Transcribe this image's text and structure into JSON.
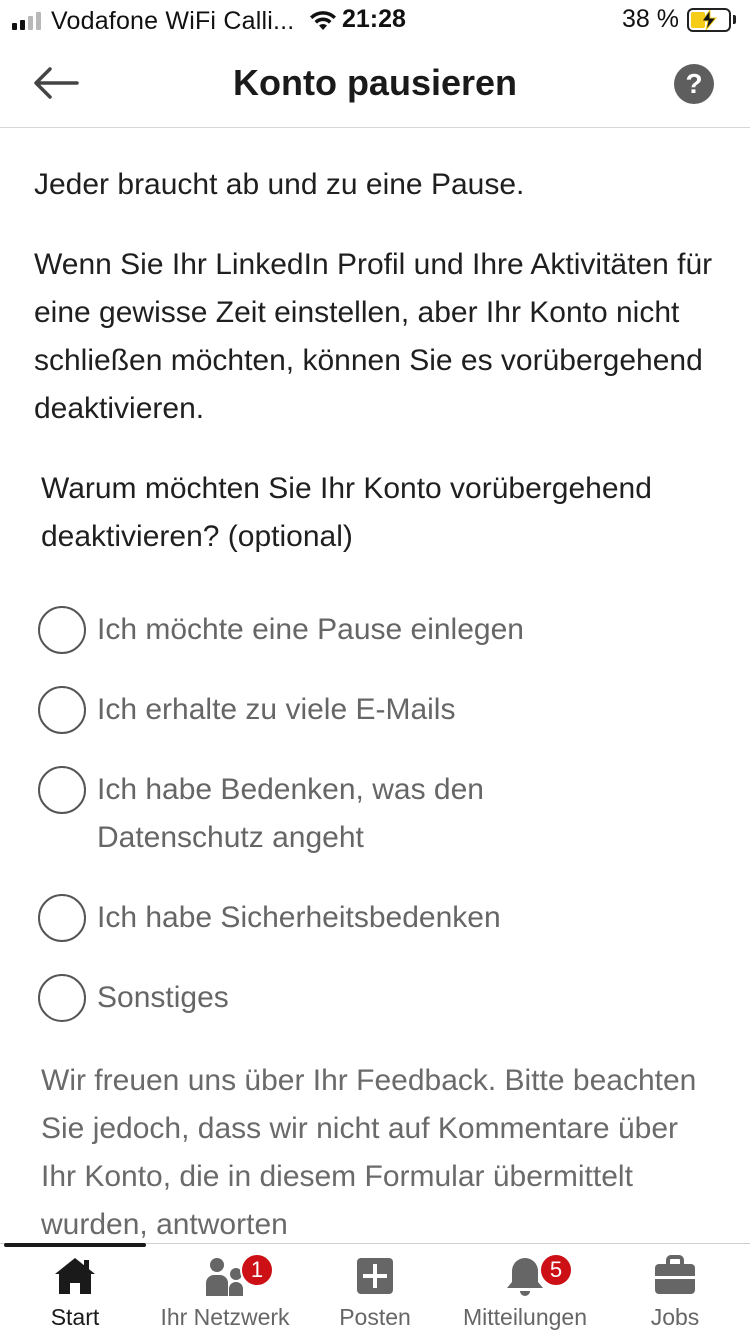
{
  "status_bar": {
    "carrier": "Vodafone WiFi Calli...",
    "time": "21:28",
    "battery": "38 %",
    "battery_level": 0.38,
    "signal_bars_active": 2,
    "icons": [
      "signal-icon",
      "wifi-icon",
      "battery-icon",
      "charging-bolt-icon"
    ]
  },
  "header": {
    "title": "Konto pausieren",
    "back_icon": "back-arrow-icon",
    "help_label": "?"
  },
  "content": {
    "intro": "Jeder braucht ab und zu eine Pause.",
    "paragraph": "Wenn Sie Ihr LinkedIn Profil und Ihre Aktivitäten für eine gewisse Zeit einstellen, aber Ihr Konto nicht schließen möchten, können Sie es vorübergehend deaktivieren.",
    "question": "Warum möchten Sie Ihr Konto vorübergehend deaktivieren? (optional)",
    "reasons": [
      {
        "label": "Ich möchte eine Pause einlegen",
        "selected": false
      },
      {
        "label": "Ich erhalte zu viele E-Mails",
        "selected": false
      },
      {
        "label": "Ich habe Bedenken, was den Datenschutz angeht",
        "selected": false
      },
      {
        "label": "Ich habe Sicherheitsbedenken",
        "selected": false
      },
      {
        "label": "Sonstiges",
        "selected": false
      }
    ],
    "feedback_note": "Wir freuen uns über Ihr Feedback. Bitte beachten Sie jedoch, dass wir nicht auf Kommentare über Ihr Konto, die in diesem Formular übermittelt wurden, antworten"
  },
  "bottom_nav": {
    "items": [
      {
        "label": "Start",
        "icon": "home-icon",
        "active": true
      },
      {
        "label": "Ihr Netzwerk",
        "icon": "network-icon",
        "badge": "1"
      },
      {
        "label": "Posten",
        "icon": "post-icon"
      },
      {
        "label": "Mitteilungen",
        "icon": "bell-icon",
        "badge": "5"
      },
      {
        "label": "Jobs",
        "icon": "briefcase-icon"
      }
    ]
  },
  "colors": {
    "accent_badge": "#cc1016",
    "battery_fill": "#f5cc17",
    "text_primary": "#1a1a1a",
    "text_secondary": "#666666"
  }
}
